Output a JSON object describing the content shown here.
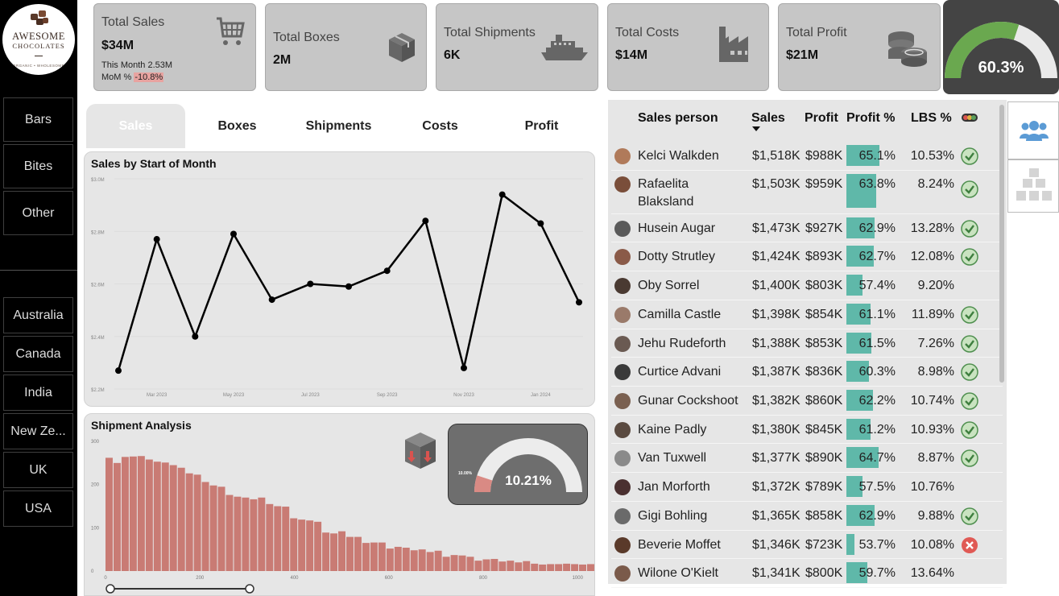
{
  "brand": {
    "line1": "AWESOME",
    "line2": "CHOCOLATES",
    "tagline": "ORGANIC • WHOLESOME"
  },
  "sidebar": {
    "categories": [
      "Bars",
      "Bites",
      "Other"
    ],
    "countries": [
      "Australia",
      "Canada",
      "India",
      "New Ze...",
      "UK",
      "USA"
    ]
  },
  "kpis": {
    "sales": {
      "title": "Total Sales",
      "value": "$34M",
      "month_label": "This Month 2.53M",
      "mom_label": "MoM %",
      "mom_value": "-10.8%",
      "icon": "cart-icon"
    },
    "boxes": {
      "title": "Total Boxes",
      "value": "2M",
      "icon": "box-icon"
    },
    "shipments": {
      "title": "Total Shipments",
      "value": "6K",
      "icon": "ship-icon"
    },
    "costs": {
      "title": "Total Costs",
      "value": "$14M",
      "icon": "factory-icon"
    },
    "profit": {
      "title": "Total Profit",
      "value": "$21M",
      "icon": "coins-icon"
    },
    "margin_gauge": {
      "value": "60.3%",
      "fraction": 0.603
    }
  },
  "tabs": [
    "Sales",
    "Boxes",
    "Shipments",
    "Costs",
    "Profit"
  ],
  "active_tab": "Sales",
  "line_panel": {
    "title": "Sales by Start of Month"
  },
  "ship_panel": {
    "title": "Shipment Analysis",
    "gauge_value": "10.21%",
    "gauge_target": "10.00%",
    "gauge_fraction": 0.1021
  },
  "chart_data": [
    {
      "type": "line",
      "title": "Sales by Start of Month",
      "x": [
        "2023-02",
        "2023-03",
        "2023-04",
        "2023-05",
        "2023-06",
        "2023-07",
        "2023-08",
        "2023-09",
        "2023-10",
        "2023-11",
        "2023-12",
        "2024-01",
        "2024-02"
      ],
      "xticks": [
        "Mar 2023",
        "May 2023",
        "Jul 2023",
        "Sep 2023",
        "Nov 2023",
        "Jan 2024"
      ],
      "values": [
        2.27,
        2.77,
        2.4,
        2.79,
        2.54,
        2.6,
        2.59,
        2.65,
        2.84,
        2.28,
        2.94,
        2.83,
        2.53
      ],
      "yticks": [
        "$2.2M",
        "$2.4M",
        "$2.6M",
        "$2.8M",
        "$3.0M"
      ],
      "ylim": [
        2.2,
        3.0
      ],
      "grid": true
    },
    {
      "type": "bar",
      "title": "Shipment Analysis",
      "xticks": [
        "0",
        "200",
        "400",
        "600",
        "800",
        "1000"
      ],
      "yticks": [
        "0",
        "100",
        "200",
        "300"
      ],
      "ylim": [
        0,
        300
      ],
      "xlim": [
        0,
        1020
      ],
      "bin_width": 17,
      "values": [
        262,
        250,
        264,
        265,
        266,
        258,
        253,
        251,
        245,
        239,
        226,
        223,
        206,
        198,
        195,
        176,
        172,
        170,
        166,
        170,
        155,
        150,
        149,
        122,
        119,
        117,
        114,
        89,
        87,
        92,
        79,
        79,
        65,
        66,
        66,
        52,
        56,
        54,
        48,
        50,
        44,
        47,
        33,
        37,
        36,
        33,
        24,
        27,
        28,
        22,
        24,
        20,
        23,
        17,
        15,
        16,
        16,
        17,
        16,
        15,
        16
      ],
      "color": "#c97b74"
    }
  ],
  "table": {
    "headers": {
      "person": "Sales person",
      "sales": "Sales",
      "profit": "Profit",
      "profit_pct": "Profit %",
      "lbs_pct": "LBS %"
    },
    "rows": [
      {
        "name": "Kelci Walkden",
        "sales": "$1,518K",
        "profit": "$988K",
        "profit_pct": "65.1%",
        "pct": 0.651,
        "lbs": "10.53%",
        "status": "ok"
      },
      {
        "name": "Rafaelita Blaksland",
        "sales": "$1,503K",
        "profit": "$959K",
        "profit_pct": "63.8%",
        "pct": 0.638,
        "lbs": "8.24%",
        "status": "ok"
      },
      {
        "name": "Husein Augar",
        "sales": "$1,473K",
        "profit": "$927K",
        "profit_pct": "62.9%",
        "pct": 0.629,
        "lbs": "13.28%",
        "status": "ok"
      },
      {
        "name": "Dotty Strutley",
        "sales": "$1,424K",
        "profit": "$893K",
        "profit_pct": "62.7%",
        "pct": 0.627,
        "lbs": "12.08%",
        "status": "ok"
      },
      {
        "name": "Oby Sorrel",
        "sales": "$1,400K",
        "profit": "$803K",
        "profit_pct": "57.4%",
        "pct": 0.574,
        "lbs": "9.20%",
        "status": "none"
      },
      {
        "name": "Camilla Castle",
        "sales": "$1,398K",
        "profit": "$854K",
        "profit_pct": "61.1%",
        "pct": 0.611,
        "lbs": "11.89%",
        "status": "ok"
      },
      {
        "name": "Jehu Rudeforth",
        "sales": "$1,388K",
        "profit": "$853K",
        "profit_pct": "61.5%",
        "pct": 0.615,
        "lbs": "7.26%",
        "status": "ok"
      },
      {
        "name": "Curtice Advani",
        "sales": "$1,387K",
        "profit": "$836K",
        "profit_pct": "60.3%",
        "pct": 0.603,
        "lbs": "8.98%",
        "status": "ok"
      },
      {
        "name": "Gunar Cockshoot",
        "sales": "$1,382K",
        "profit": "$860K",
        "profit_pct": "62.2%",
        "pct": 0.622,
        "lbs": "10.74%",
        "status": "ok"
      },
      {
        "name": "Kaine Padly",
        "sales": "$1,380K",
        "profit": "$845K",
        "profit_pct": "61.2%",
        "pct": 0.612,
        "lbs": "10.93%",
        "status": "ok"
      },
      {
        "name": "Van Tuxwell",
        "sales": "$1,377K",
        "profit": "$890K",
        "profit_pct": "64.7%",
        "pct": 0.647,
        "lbs": "8.87%",
        "status": "ok"
      },
      {
        "name": "Jan Morforth",
        "sales": "$1,372K",
        "profit": "$789K",
        "profit_pct": "57.5%",
        "pct": 0.575,
        "lbs": "10.76%",
        "status": "none"
      },
      {
        "name": "Gigi Bohling",
        "sales": "$1,365K",
        "profit": "$858K",
        "profit_pct": "62.9%",
        "pct": 0.629,
        "lbs": "9.88%",
        "status": "ok"
      },
      {
        "name": "Beverie Moffet",
        "sales": "$1,346K",
        "profit": "$723K",
        "profit_pct": "53.7%",
        "pct": 0.537,
        "lbs": "10.08%",
        "status": "bad"
      },
      {
        "name": "Wilone O'Kielt",
        "sales": "$1,341K",
        "profit": "$800K",
        "profit_pct": "59.7%",
        "pct": 0.597,
        "lbs": "13.64%",
        "status": "none"
      }
    ]
  },
  "colors": {
    "accent_green": "#6aa84f",
    "bar_teal": "#5fb8a9",
    "bar_red": "#c97b74",
    "ok_green": "#5a9e5a",
    "bad_red": "#d9534f",
    "card_gray": "#c6c6c6"
  },
  "right_buttons": [
    "people-icon",
    "boxes-stack-icon"
  ]
}
